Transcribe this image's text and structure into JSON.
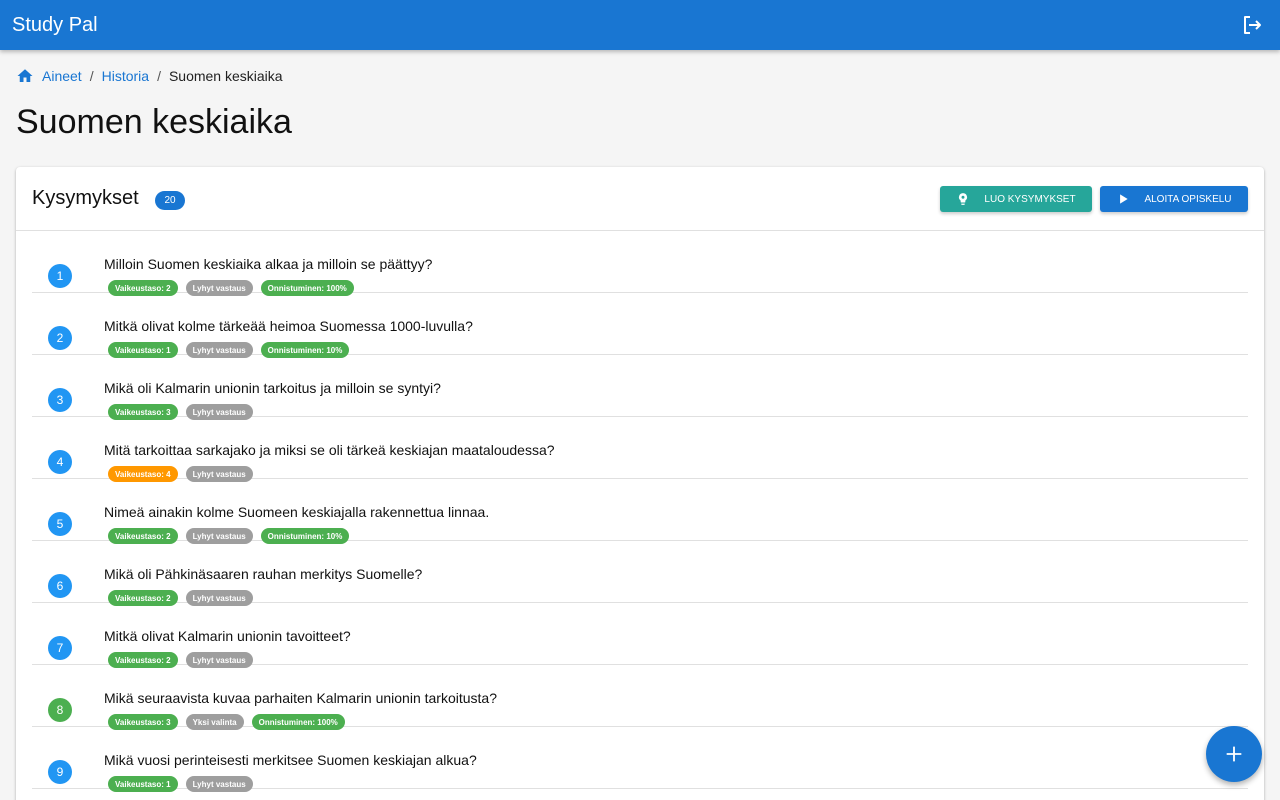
{
  "app": {
    "title": "Study Pal"
  },
  "breadcrumb": {
    "items": [
      "Aineet",
      "Historia"
    ],
    "current": "Suomen keskiaika",
    "separator": "/"
  },
  "page": {
    "title": "Suomen keskiaika"
  },
  "card": {
    "title": "Kysymykset",
    "count": "20",
    "generate_label": "LUO KYSYMYKSET",
    "study_label": "ALOITA OPISKELU"
  },
  "colors": {
    "primary": "#1976d2",
    "teal": "#26a69a",
    "green": "#4caf50",
    "orange": "#ff9800",
    "grey": "#9e9e9e"
  },
  "questions": [
    {
      "number": "1",
      "text": "Milloin Suomen keskiaika alkaa ja milloin se päättyy?",
      "difficulty": "Vaikeustaso: 2",
      "difficulty_color": "green",
      "type": "Lyhyt vastaus",
      "success": "Onnistuminen: 100%",
      "number_color": "blue"
    },
    {
      "number": "2",
      "text": "Mitkä olivat kolme tärkeää heimoa Suomessa 1000-luvulla?",
      "difficulty": "Vaikeustaso: 1",
      "difficulty_color": "green",
      "type": "Lyhyt vastaus",
      "success": "Onnistuminen: 10%",
      "number_color": "blue"
    },
    {
      "number": "3",
      "text": "Mikä oli Kalmarin unionin tarkoitus ja milloin se syntyi?",
      "difficulty": "Vaikeustaso: 3",
      "difficulty_color": "green",
      "type": "Lyhyt vastaus",
      "success": "",
      "number_color": "blue"
    },
    {
      "number": "4",
      "text": "Mitä tarkoittaa sarkajako ja miksi se oli tärkeä keskiajan maataloudessa?",
      "difficulty": "Vaikeustaso: 4",
      "difficulty_color": "orange",
      "type": "Lyhyt vastaus",
      "success": "",
      "number_color": "blue"
    },
    {
      "number": "5",
      "text": "Nimeä ainakin kolme Suomeen keskiajalla rakennettua linnaa.",
      "difficulty": "Vaikeustaso: 2",
      "difficulty_color": "green",
      "type": "Lyhyt vastaus",
      "success": "Onnistuminen: 10%",
      "number_color": "blue"
    },
    {
      "number": "6",
      "text": "Mikä oli Pähkinäsaaren rauhan merkitys Suomelle?",
      "difficulty": "Vaikeustaso: 2",
      "difficulty_color": "green",
      "type": "Lyhyt vastaus",
      "success": "",
      "number_color": "blue"
    },
    {
      "number": "7",
      "text": "Mitkä olivat Kalmarin unionin tavoitteet?",
      "difficulty": "Vaikeustaso: 2",
      "difficulty_color": "green",
      "type": "Lyhyt vastaus",
      "success": "",
      "number_color": "blue"
    },
    {
      "number": "8",
      "text": "Mikä seuraavista kuvaa parhaiten Kalmarin unionin tarkoitusta?",
      "difficulty": "Vaikeustaso: 3",
      "difficulty_color": "green",
      "type": "Yksi valinta",
      "success": "Onnistuminen: 100%",
      "number_color": "green"
    },
    {
      "number": "9",
      "text": "Mikä vuosi perinteisesti merkitsee Suomen keskiajan alkua?",
      "difficulty": "Vaikeustaso: 1",
      "difficulty_color": "green",
      "type": "Lyhyt vastaus",
      "success": "",
      "number_color": "blue"
    }
  ]
}
